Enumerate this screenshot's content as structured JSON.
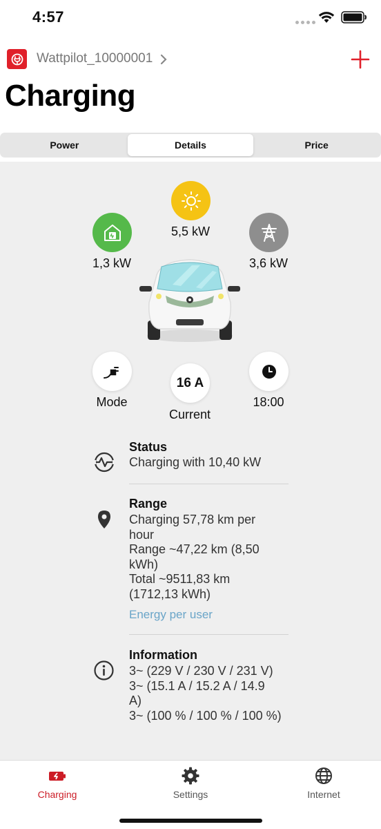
{
  "status_bar": {
    "time": "4:57"
  },
  "header": {
    "device_name": "Wattpilot_10000001",
    "title": "Charging"
  },
  "tabs": [
    {
      "label": "Power"
    },
    {
      "label": "Details"
    },
    {
      "label": "Price"
    }
  ],
  "active_tab": "Details",
  "energy_flow": {
    "solar": {
      "value": "5,5 kW",
      "icon": "sun-icon",
      "color": "#f5c314"
    },
    "home": {
      "value": "1,3 kW",
      "icon": "house-icon",
      "color": "#55b94a"
    },
    "grid": {
      "value": "3,6 kW",
      "icon": "power-pylon-icon",
      "color": "#8e8e8e"
    }
  },
  "controls": {
    "mode": {
      "label": "Mode",
      "icon": "plug-icon"
    },
    "current": {
      "value": "16 A",
      "label": "Current"
    },
    "time": {
      "value": "18:00",
      "icon": "clock-icon"
    }
  },
  "status": {
    "title": "Status",
    "text": "Charging with 10,40 kW"
  },
  "range": {
    "title": "Range",
    "lines": [
      "Charging 57,78 km per",
      "hour",
      "Range ~47,22 km (8,50",
      "kWh)",
      "Total ~9511,83 km",
      "(1712,13 kWh)"
    ],
    "link": "Energy per user"
  },
  "information": {
    "title": "Information",
    "lines": [
      "3~ (229 V / 230 V / 231 V)",
      "3~ (15.1 A / 15.2 A / 14.9",
      "A)",
      "3~ (100 % / 100 % / 100 %)"
    ]
  },
  "tabbar": [
    {
      "label": "Charging",
      "icon": "charging-icon"
    },
    {
      "label": "Settings",
      "icon": "gear-icon"
    },
    {
      "label": "Internet",
      "icon": "globe-icon"
    }
  ],
  "colors": {
    "accent": "#e0202a",
    "link": "#6aa5c8",
    "background": "#efefef"
  }
}
